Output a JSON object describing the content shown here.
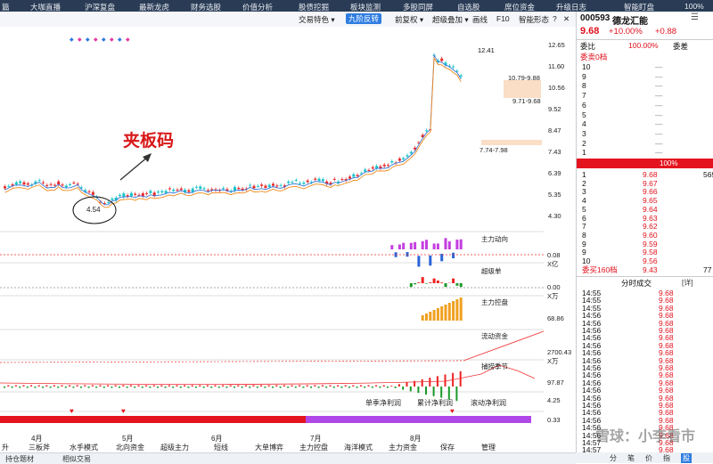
{
  "nav": [
    "篇",
    "大咖直播",
    "沪深复盘",
    "最新龙虎",
    "财务选股",
    "价值分析",
    "股债挖掘",
    "板块监测",
    "多股同屏",
    "自选股",
    "席位资金",
    "升级日志",
    "智能盯盘",
    "100%"
  ],
  "toolbar": {
    "items": [
      "交易特色 ▾",
      "九阶反转",
      "前复权 ▾",
      "超级叠加 ▾",
      "画线",
      "F10",
      "智能形态"
    ],
    "active_index": 1
  },
  "price_axis": [
    "12.65",
    "11.60",
    "10.56",
    "9.52",
    "8.47",
    "7.43",
    "6.39",
    "5.35",
    "4.30"
  ],
  "annotations": {
    "title": "夹板码",
    "low_label": "4.54",
    "high_label": "12.41",
    "label_a": "10.79-9.88",
    "label_b": "9.71-9.68",
    "label_c": "7.74-7.98"
  },
  "indicators": [
    {
      "name": "主力动向",
      "value": "0.08",
      "unit": "X亿"
    },
    {
      "name": "超级单",
      "value": "0.00",
      "unit": "X万"
    },
    {
      "name": "主力控盘",
      "value": "68.86",
      "unit": ""
    },
    {
      "name": "流动资金",
      "value": "2700.43",
      "unit": "X万"
    },
    {
      "name": "捕捞季节",
      "value": "97.87",
      "unit": ""
    },
    {
      "name": "",
      "value": "4.25",
      "unit": ""
    }
  ],
  "legend": [
    "单季净利润",
    "累计净利润",
    "滚动净利润"
  ],
  "last_value": "0.33",
  "xaxis": {
    "months": [
      "4月",
      "5月",
      "6月",
      "7月",
      "8月"
    ],
    "strategies": [
      "升",
      "三板斧",
      "水手模式",
      "北向资金",
      "超级主力",
      "短线",
      "大单博弈",
      "主力控盘",
      "海洋模式",
      "主力资金",
      "保存",
      "管理"
    ]
  },
  "bottom_tabs": [
    "持仓题材",
    "相似交易"
  ],
  "quote": {
    "code": "000593",
    "name": "德龙汇能",
    "price": "9.68",
    "pct": "+10.00%",
    "chg": "+0.88",
    "webi_label": "委比",
    "webi_value": "100.00%",
    "weicha_label": "委差",
    "sell_label": "委卖0档",
    "sell_levels": [
      "10",
      "9",
      "8",
      "7",
      "6",
      "5",
      "4",
      "3",
      "2",
      "1"
    ],
    "sell_dash": "—",
    "bar_label": "100%",
    "buy_levels": [
      {
        "lvl": "1",
        "price": "9.68",
        "vol": "569"
      },
      {
        "lvl": "2",
        "price": "9.67",
        "vol": ""
      },
      {
        "lvl": "3",
        "price": "9.66",
        "vol": ""
      },
      {
        "lvl": "4",
        "price": "9.65",
        "vol": ""
      },
      {
        "lvl": "5",
        "price": "9.64",
        "vol": ""
      },
      {
        "lvl": "6",
        "price": "9.63",
        "vol": ""
      },
      {
        "lvl": "7",
        "price": "9.62",
        "vol": ""
      },
      {
        "lvl": "8",
        "price": "9.60",
        "vol": ""
      },
      {
        "lvl": "9",
        "price": "9.59",
        "vol": ""
      },
      {
        "lvl": "9",
        "price": "9.58",
        "vol": ""
      },
      {
        "lvl": "10",
        "price": "9.56",
        "vol": ""
      }
    ],
    "buy_total_label": "委买160档",
    "buy_total_price": "9.43",
    "buy_total_vol": "77",
    "trades_title": "分时成交",
    "trades_detail": "[详]",
    "trades": [
      {
        "t": "14:55",
        "p": "9.68"
      },
      {
        "t": "14:55",
        "p": "9.68"
      },
      {
        "t": "14:55",
        "p": "9.68"
      },
      {
        "t": "14:56",
        "p": "9.68"
      },
      {
        "t": "14:56",
        "p": "9.68"
      },
      {
        "t": "14:56",
        "p": "9.68"
      },
      {
        "t": "14:56",
        "p": "9.68"
      },
      {
        "t": "14:56",
        "p": "9.68"
      },
      {
        "t": "14:56",
        "p": "9.68"
      },
      {
        "t": "14:56",
        "p": "9.68"
      },
      {
        "t": "14:56",
        "p": "9.68"
      },
      {
        "t": "14:56",
        "p": "9.68"
      },
      {
        "t": "14:56",
        "p": "9.68"
      },
      {
        "t": "14:56",
        "p": "9.68"
      },
      {
        "t": "14:56",
        "p": "9.68"
      },
      {
        "t": "14:56",
        "p": "9.68"
      },
      {
        "t": "14:56",
        "p": "9.68"
      },
      {
        "t": "14:56",
        "p": "9.68"
      },
      {
        "t": "14:56",
        "p": "9.68"
      },
      {
        "t": "14:56",
        "p": "9.68"
      },
      {
        "t": "14:57",
        "p": "9.68"
      },
      {
        "t": "14:57",
        "p": "9.68"
      },
      {
        "t": "14:57",
        "p": "9.68"
      }
    ],
    "panel_tabs": [
      "分",
      "笔",
      "价",
      "指",
      "股"
    ]
  },
  "watermark": "雪球：小李看市"
}
